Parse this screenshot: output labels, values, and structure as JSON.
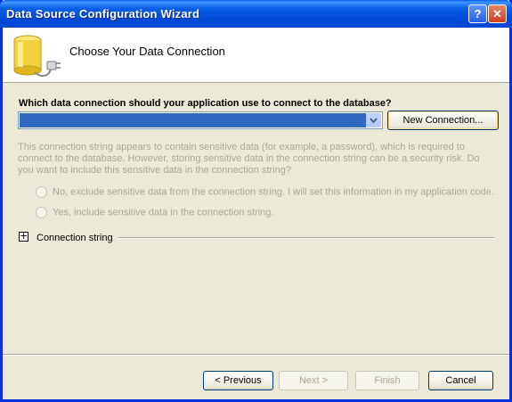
{
  "window": {
    "title": "Data Source Configuration Wizard",
    "help_glyph": "?",
    "close_glyph": "✕"
  },
  "header": {
    "title": "Choose Your Data Connection",
    "icon": "database-plug-icon"
  },
  "connection": {
    "question": "Which data connection should your application use to connect to the database?",
    "selected_value": "",
    "new_connection_label": "New Connection..."
  },
  "sensitive": {
    "text": "This connection string appears to contain sensitive data (for example, a password), which is required to connect to the database. However, storing sensitive data in the connection string can be a security risk. Do you want to include this sensitive data in the connection string?",
    "options": [
      "No, exclude sensitive data from the connection string. I will set this information in my application code.",
      "Yes, include sensitive data in the connection string."
    ]
  },
  "connection_string": {
    "expander_glyph": "+",
    "label": "Connection string"
  },
  "buttons": {
    "previous": "< Previous",
    "next": "Next >",
    "finish": "Finish",
    "cancel": "Cancel"
  },
  "colors": {
    "title_bar": "#0054e3",
    "selection": "#316ac5",
    "dialog_bg": "#ece9d8",
    "disabled_text": "#aca899"
  }
}
